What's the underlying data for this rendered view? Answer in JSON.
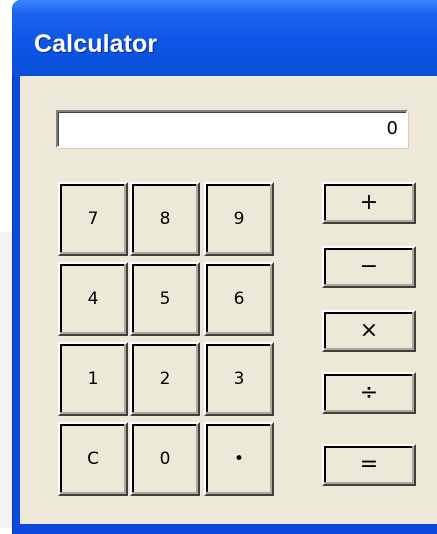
{
  "window": {
    "title": "Calculator"
  },
  "display": {
    "value": "0"
  },
  "keypad": {
    "k7": "7",
    "k8": "8",
    "k9": "9",
    "k4": "4",
    "k5": "5",
    "k6": "6",
    "k1": "1",
    "k2": "2",
    "k3": "3",
    "clear": "C",
    "k0": "0",
    "dot": "•"
  },
  "operators": {
    "add": "+",
    "subtract": "−",
    "multiply": "×",
    "divide": "÷",
    "equals": "="
  },
  "colors": {
    "titlebar": "#0b55e6",
    "client": "#ece9d8",
    "display_bg": "#ffffff"
  }
}
